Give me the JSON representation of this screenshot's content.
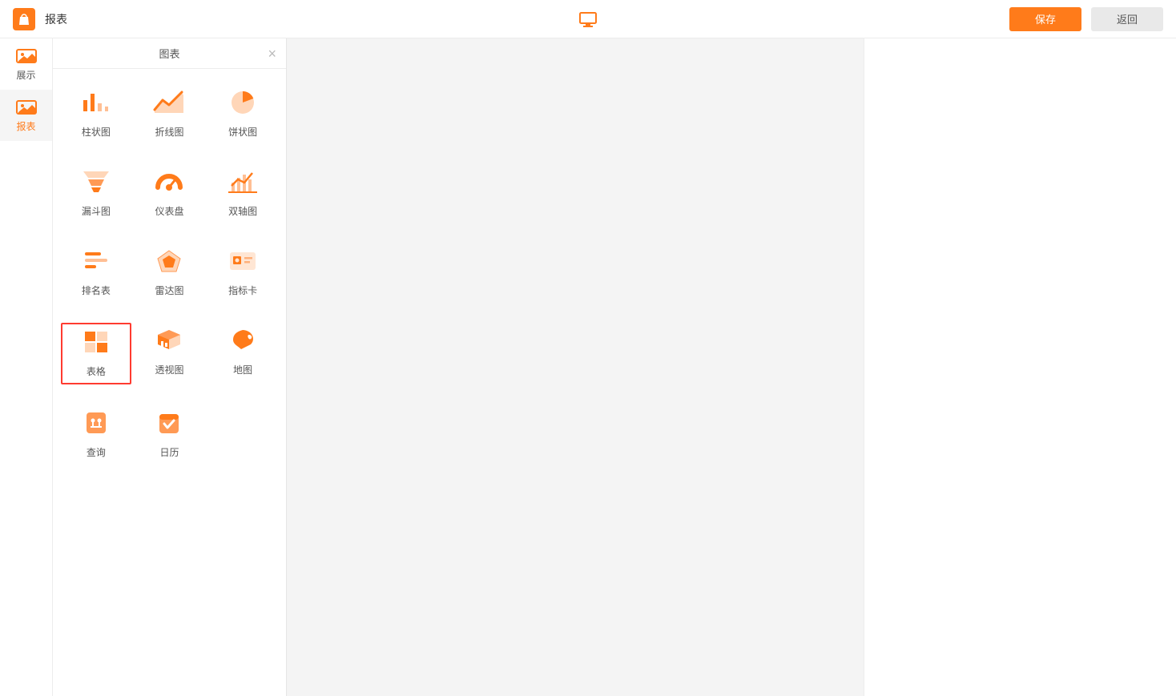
{
  "header": {
    "appTitle": "报表",
    "saveLabel": "保存",
    "backLabel": "返回"
  },
  "leftNav": {
    "items": [
      {
        "label": "展示",
        "active": false
      },
      {
        "label": "报表",
        "active": true
      }
    ]
  },
  "picker": {
    "title": "图表",
    "items": [
      {
        "label": "柱状图",
        "icon": "bar-chart-icon",
        "highlighted": false
      },
      {
        "label": "折线图",
        "icon": "line-chart-icon",
        "highlighted": false
      },
      {
        "label": "饼状图",
        "icon": "pie-chart-icon",
        "highlighted": false
      },
      {
        "label": "漏斗图",
        "icon": "funnel-chart-icon",
        "highlighted": false
      },
      {
        "label": "仪表盘",
        "icon": "gauge-chart-icon",
        "highlighted": false
      },
      {
        "label": "双轴图",
        "icon": "dual-axis-chart-icon",
        "highlighted": false
      },
      {
        "label": "排名表",
        "icon": "ranking-table-icon",
        "highlighted": false
      },
      {
        "label": "雷达图",
        "icon": "radar-chart-icon",
        "highlighted": false
      },
      {
        "label": "指标卡",
        "icon": "kpi-card-icon",
        "highlighted": false
      },
      {
        "label": "表格",
        "icon": "table-icon",
        "highlighted": true
      },
      {
        "label": "透视图",
        "icon": "pivot-chart-icon",
        "highlighted": false
      },
      {
        "label": "地图",
        "icon": "map-chart-icon",
        "highlighted": false
      },
      {
        "label": "查询",
        "icon": "query-icon",
        "highlighted": false
      },
      {
        "label": "日历",
        "icon": "calendar-icon",
        "highlighted": false
      }
    ]
  },
  "colors": {
    "accent": "#ff7b1a",
    "accentLight": "#ffd6b8",
    "highlightBorder": "#ff3b30"
  }
}
